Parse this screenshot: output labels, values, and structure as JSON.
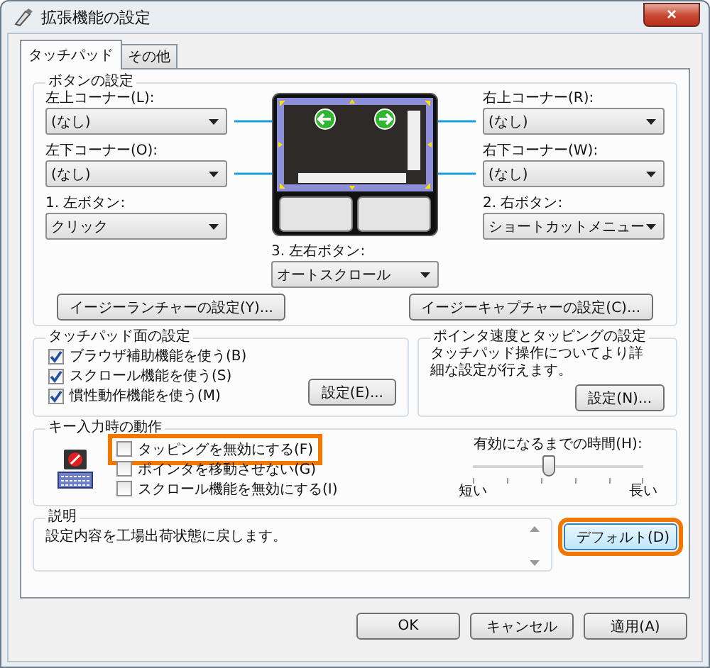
{
  "window": {
    "title": "拡張機能の設定",
    "close": "×"
  },
  "tabs": [
    {
      "label": "タッチパッド",
      "selected": true
    },
    {
      "label": "その他",
      "selected": false
    }
  ],
  "button_settings": {
    "title": "ボタンの設定",
    "corners": [
      {
        "label": "左上コーナー(L):",
        "value": "(なし)"
      },
      {
        "label": "左下コーナー(O):",
        "value": "(なし)"
      },
      {
        "label": "右上コーナー(R):",
        "value": "(なし)"
      },
      {
        "label": "右下コーナー(W):",
        "value": "(なし)"
      }
    ],
    "buttons": [
      {
        "label": "1. 左ボタン:",
        "value": "クリック"
      },
      {
        "label": "2. 右ボタン:",
        "value": "ショートカットメニュー"
      },
      {
        "label": "3. 左右ボタン:",
        "value": "オートスクロール"
      }
    ],
    "actions": [
      "イージーランチャーの設定(Y)...",
      "イージーキャプチャーの設定(C)..."
    ]
  },
  "pad_surface": {
    "title": "タッチパッド面の設定",
    "options": [
      {
        "label": "ブラウザ補助機能を使う(B)",
        "checked": true
      },
      {
        "label": "スクロール機能を使う(S)",
        "checked": true
      },
      {
        "label": "慣性動作機能を使う(M)",
        "checked": true
      }
    ],
    "button": "設定(E)..."
  },
  "pointer": {
    "title": "ポインタ速度とタッピングの設定",
    "text": "タッチパッド操作についてより詳細な設定が行えます。",
    "button": "設定(N)..."
  },
  "key_input": {
    "title": "キー入力時の動作",
    "options": [
      {
        "label": "タッピングを無効にする(F)",
        "checked": false,
        "highlighted": true
      },
      {
        "label": "ポインタを移動させない(G)",
        "checked": false,
        "highlighted": false
      },
      {
        "label": "スクロール機能を無効にする(I)",
        "checked": false,
        "highlighted": false
      }
    ],
    "delay": {
      "label": "有効になるまでの時間(H):",
      "level": 0.45,
      "min_label": "短い",
      "max_label": "長い"
    }
  },
  "description": {
    "title": "説明",
    "text": "設定内容を工場出荷状態に戻します。"
  },
  "default_button": {
    "label": "デフォルト(D)",
    "highlighted": true
  },
  "dialog_buttons": [
    "OK",
    "キャンセル",
    "適用(A)"
  ]
}
